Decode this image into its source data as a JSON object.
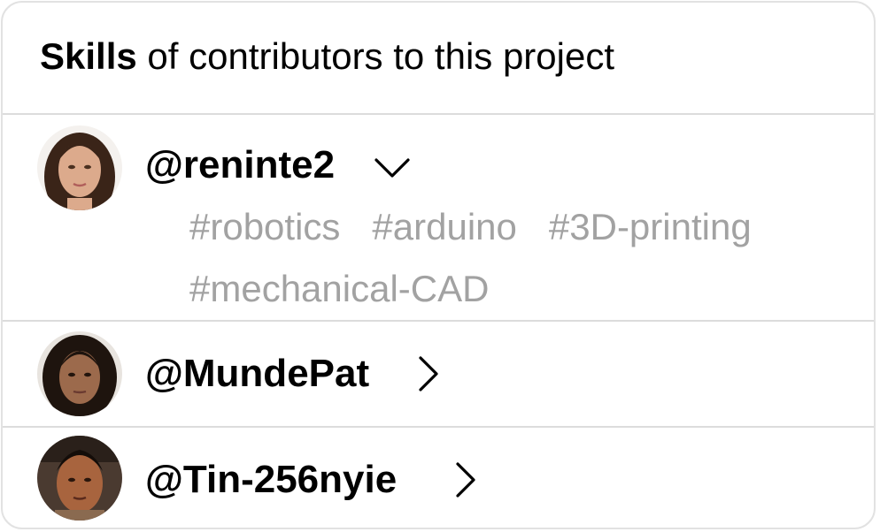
{
  "header": {
    "title_strong": "Skills",
    "title_rest": " of contributors to this project"
  },
  "contributors": [
    {
      "handle": "@reninte2",
      "expanded": true,
      "toggle_icon": "chevron-down-icon",
      "tags": [
        "#robotics",
        "#arduino",
        "#3D-printing",
        "#mechanical-CAD"
      ]
    },
    {
      "handle": "@MundePat",
      "expanded": false,
      "toggle_icon": "chevron-right-icon",
      "tags": []
    },
    {
      "handle": "@Tin-256nyie",
      "expanded": false,
      "toggle_icon": "chevron-right-icon",
      "tags": []
    }
  ],
  "colors": {
    "tag_text": "#a2a2a2",
    "divider": "#dcdcdc",
    "card_border": "#e2e2e2"
  }
}
